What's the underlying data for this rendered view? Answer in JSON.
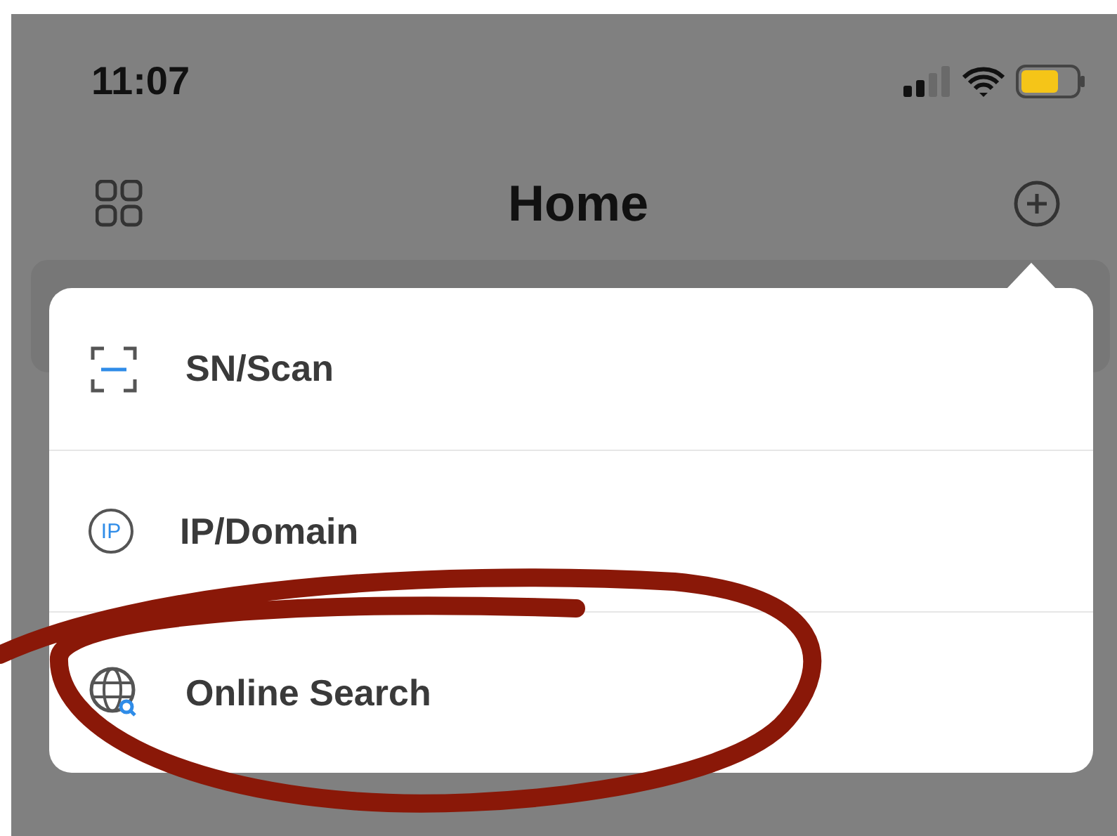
{
  "status_bar": {
    "time": "11:07"
  },
  "nav": {
    "title": "Home"
  },
  "menu": {
    "items": [
      {
        "kind": "scan",
        "label": "SN/Scan"
      },
      {
        "kind": "ip",
        "label": "IP/Domain",
        "icon_text": "IP"
      },
      {
        "kind": "globe",
        "label": "Online Search"
      }
    ]
  }
}
